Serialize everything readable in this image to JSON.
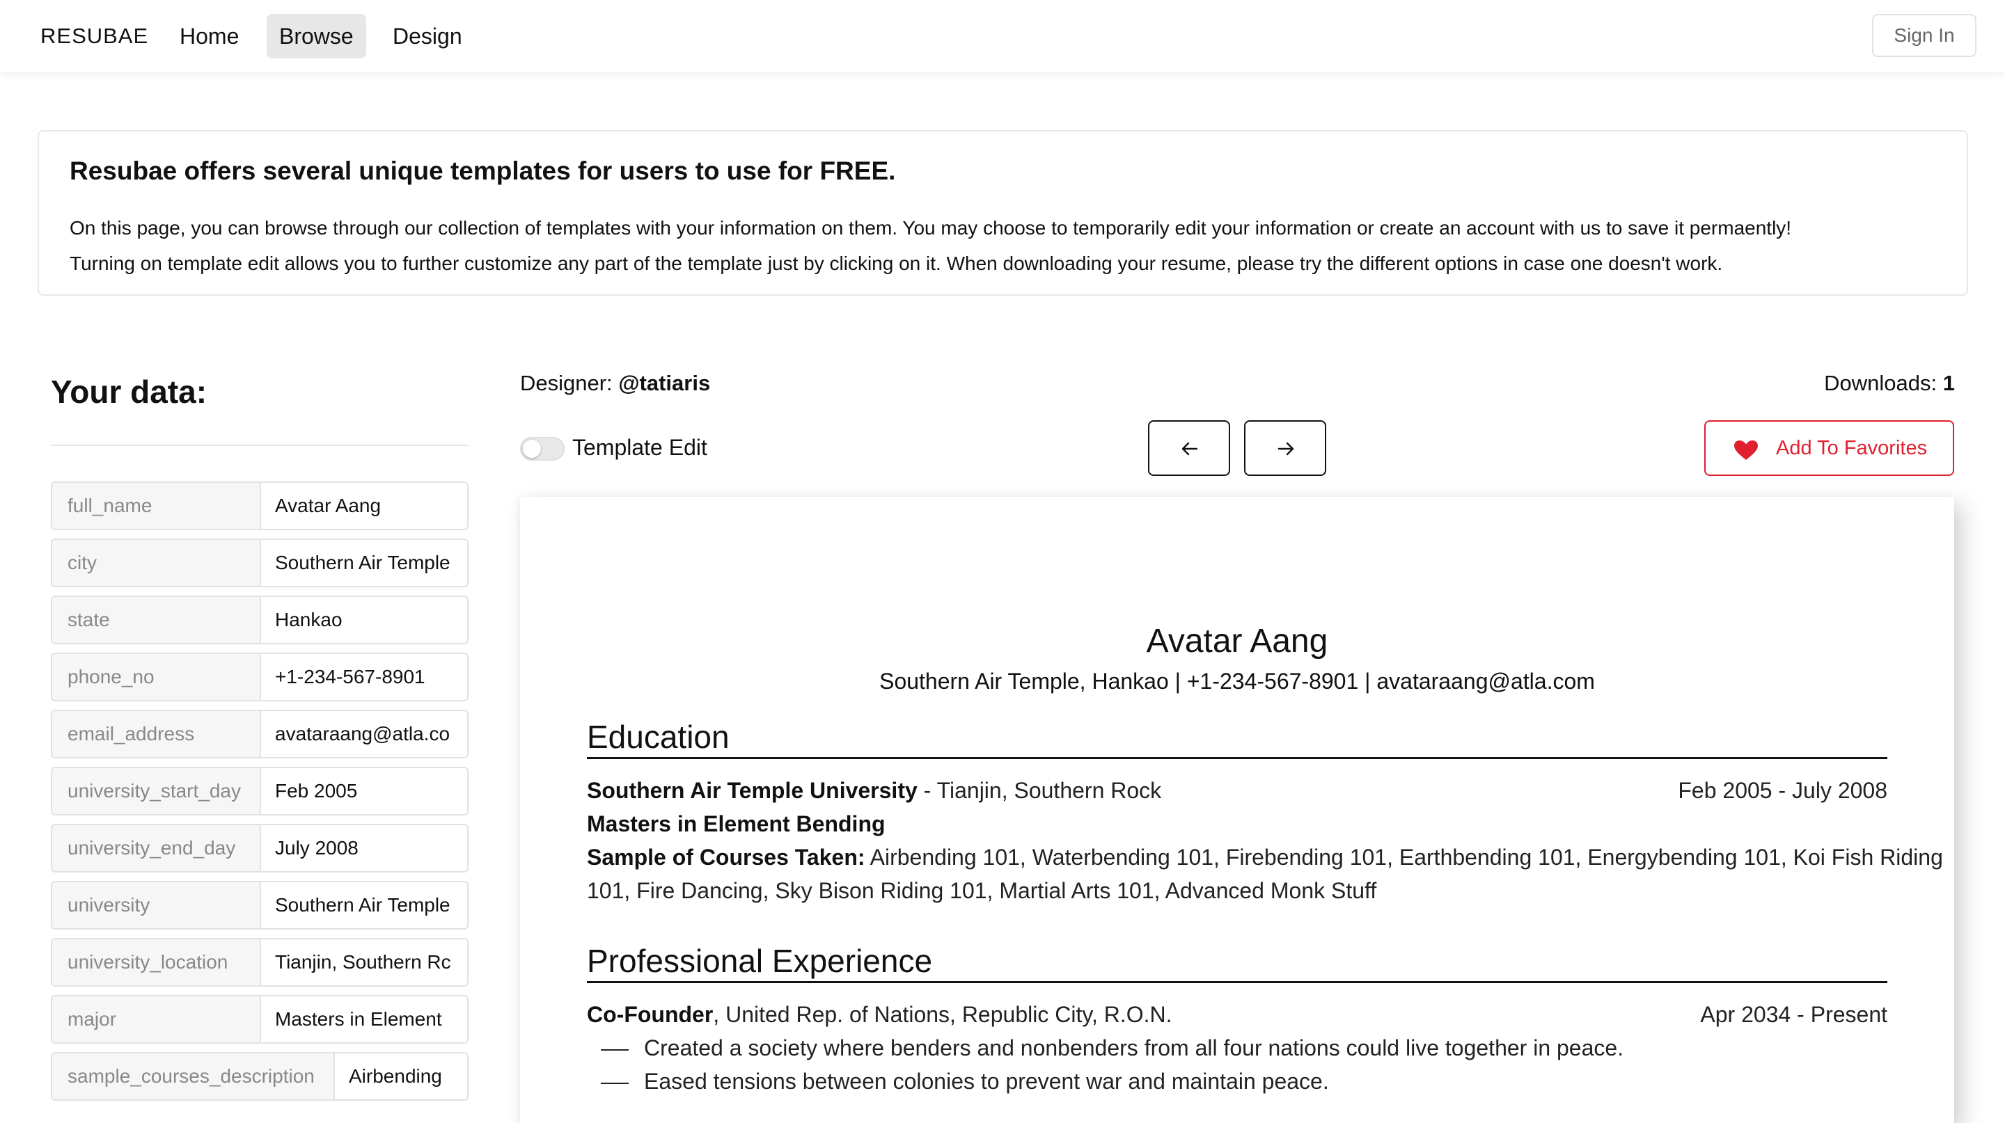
{
  "nav": {
    "brand": "RESUBAE",
    "items": [
      "Home",
      "Browse",
      "Design"
    ],
    "active": "Browse",
    "sign_in": "Sign In"
  },
  "info": {
    "title": "Resubae offers several unique templates for users to use for FREE.",
    "line1": "On this page, you can browse through our collection of templates with your information on them. You may choose to temporarily edit your information or create an account with us to save it permaently!",
    "line2": "Turning on template edit allows you to further customize any part of the template just by clicking on it. When downloading your resume, please try the different options in case one doesn't work."
  },
  "data_panel": {
    "title": "Your data:",
    "rows": [
      {
        "key": "full_name",
        "value": "Avatar Aang"
      },
      {
        "key": "city",
        "value": "Southern Air Temple"
      },
      {
        "key": "state",
        "value": "Hankao"
      },
      {
        "key": "phone_no",
        "value": "+1-234-567-8901"
      },
      {
        "key": "email_address",
        "value": "avataraang@atla.co"
      },
      {
        "key": "university_start_day",
        "value": "Feb 2005"
      },
      {
        "key": "university_end_day",
        "value": "July 2008"
      },
      {
        "key": "university",
        "value": "Southern Air Temple"
      },
      {
        "key": "university_location",
        "value": "Tianjin, Southern Rc"
      },
      {
        "key": "major",
        "value": "Masters in Element"
      },
      {
        "key": "sample_courses_description",
        "value": "Airbending"
      }
    ]
  },
  "template": {
    "designer_label": "Designer:",
    "designer": "@tatiaris",
    "downloads_label": "Downloads:",
    "downloads": "1",
    "toggle_label": "Template Edit",
    "toggle_on": false,
    "favorite_label": "Add To Favorites",
    "accent_color": "#e0202f"
  },
  "resume": {
    "name": "Avatar Aang",
    "contact": "Southern Air Temple, Hankao | +1-234-567-8901 | avataraang@atla.com",
    "education_heading": "Education",
    "university": "Southern Air Temple University",
    "university_location": " - Tianjin, Southern Rock",
    "edu_dates": "Feb 2005 - July 2008",
    "degree": "Masters in Element Bending",
    "courses_label": "Sample of Courses Taken:",
    "courses_line1": " Airbending 101, Waterbending 101, Firebending 101, Earthbending 101, Energybending 101, Koi Fish Riding",
    "courses_line2": "101, Fire Dancing, Sky Bison Riding 101, Martial Arts 101, Advanced Monk Stuff",
    "experience_heading": "Professional Experience",
    "job_title": "Co-Founder",
    "job_org": ", United Rep. of Nations, Republic City, R.O.N.",
    "job_dates": "Apr 2034 - Present",
    "bullets": [
      "Created a society where benders and nonbenders from all four nations could live together in peace.",
      "Eased tensions between colonies to prevent war and maintain peace."
    ]
  }
}
